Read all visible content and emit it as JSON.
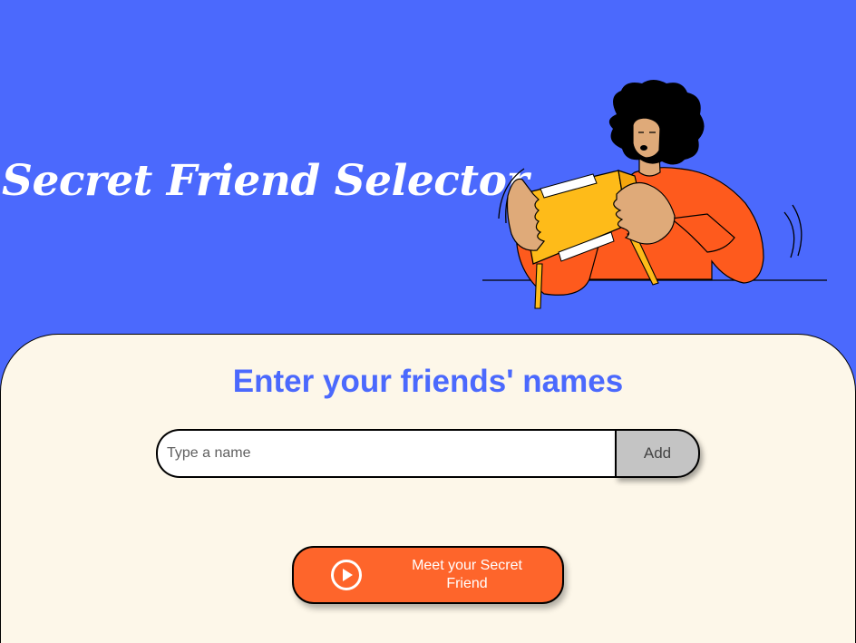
{
  "header": {
    "title": "Secret Friend Selector"
  },
  "illustration": {
    "icon": "person-opening-box-illustration"
  },
  "main": {
    "subtitle": "Enter your friends' names",
    "input": {
      "placeholder": "Type a name",
      "value": ""
    },
    "add_label": "Add",
    "meet_label": "Meet your Secret Friend",
    "meet_icon": "play-circle-icon"
  },
  "colors": {
    "background": "#4B69FD",
    "panel": "#FDF7E9",
    "accent_text": "#4B69FD",
    "add_button": "#C4C4C4",
    "meet_button": "#FE652B"
  }
}
